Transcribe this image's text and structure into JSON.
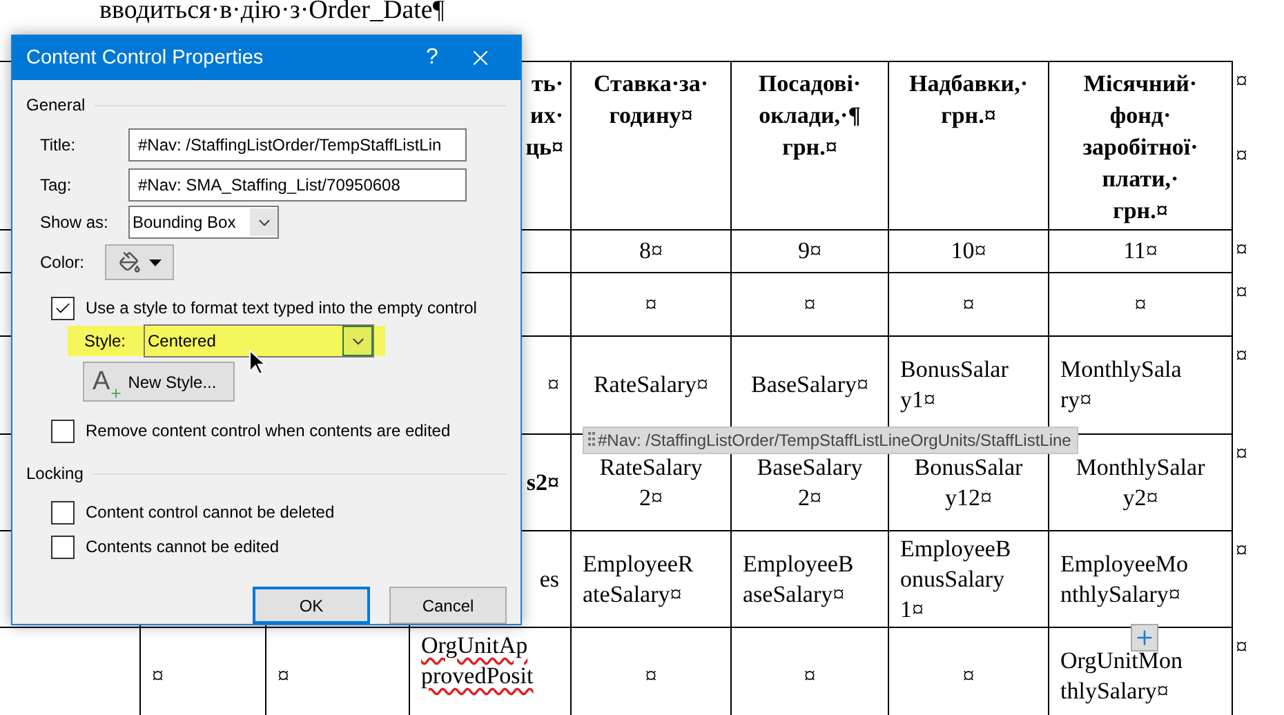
{
  "document": {
    "heading": "вводиться·в·дію·з·Order_Date¶",
    "rows": [
      {
        "kind": "header",
        "end_marks": [
          "¤",
          "¤"
        ],
        "cells": [
          {},
          {},
          {},
          {
            "text": "ть·\nих·\nць¤"
          },
          {
            "text": "Ставка·за·\nгодину¤"
          },
          {
            "text": "Посадові·\nоклади,·¶\nгрн.¤"
          },
          {
            "text": "Надбавки,·\nгрн.¤"
          },
          {
            "text": "Місячний·\nфонд·\nзаробітної·\nплати,·\nгрн.¤"
          }
        ]
      },
      {
        "kind": "body",
        "end_marks": [
          "¤"
        ],
        "cells": [
          {},
          {},
          {},
          {},
          {
            "text": "8¤"
          },
          {
            "text": "9¤"
          },
          {
            "text": "10¤"
          },
          {
            "text": "11¤"
          }
        ]
      },
      {
        "kind": "body",
        "end_marks": [
          "¤"
        ],
        "cells": [
          {},
          {},
          {},
          {},
          {
            "text": "¤"
          },
          {
            "text": "¤"
          },
          {
            "text": "¤"
          },
          {
            "text": "¤"
          }
        ]
      },
      {
        "kind": "body",
        "end_marks": [
          "¤"
        ],
        "cells": [
          {},
          {},
          {},
          {
            "text": "¤"
          },
          {
            "text": "RateSalary¤"
          },
          {
            "text": "BaseSalary¤"
          },
          {
            "text": "BonusSalar\ny1¤"
          },
          {
            "text": "MonthlySala\nry¤"
          }
        ]
      },
      {
        "kind": "body",
        "end_marks": [
          "¤"
        ],
        "cells": [
          {},
          {},
          {},
          {
            "text": "s2¤",
            "bold": true
          },
          {
            "text": "RateSalary\n2¤"
          },
          {
            "text": "BaseSalary\n2¤"
          },
          {
            "text": "BonusSalar\ny12¤"
          },
          {
            "text": "MonthlySalar\ny2¤"
          }
        ]
      },
      {
        "kind": "body",
        "end_marks": [
          "¤"
        ],
        "cells": [
          {},
          {},
          {},
          {
            "text": "es"
          },
          {
            "text": "EmployeeR\nateSalary¤"
          },
          {
            "text": "EmployeeB\naseSalary¤"
          },
          {
            "text": "EmployeeB\nonusSalary\n1¤"
          },
          {
            "text": "EmployeeMo\nnthlySalary¤"
          }
        ]
      },
      {
        "kind": "body",
        "end_marks": [
          "¤"
        ],
        "cells": [
          {},
          {
            "text": "¤"
          },
          {
            "text": "¤"
          },
          {
            "text": "OrgUnitAp\nprovedPosit",
            "spelling_error": true
          },
          {
            "text": "¤"
          },
          {
            "text": "¤"
          },
          {
            "text": "¤"
          },
          {
            "text": "OrgUnitMon\nthlySalary¤"
          }
        ]
      }
    ]
  },
  "content_control_tag": "#Nav: /StaffingListOrder/TempStaffListLineOrgUnits/StaffListLine",
  "dialog": {
    "title": "Content Control Properties",
    "help": "?",
    "general": {
      "label": "General",
      "fields": [
        {
          "kind": "text",
          "label": "Title:",
          "value": "#Nav: /StaffingListOrder/TempStaffListLin"
        },
        {
          "kind": "text",
          "label": "Tag:",
          "value": "#Nav: SMA_Staffing_List/70950608"
        },
        {
          "kind": "select",
          "label": "Show as:",
          "value": "Bounding Box"
        },
        {
          "kind": "color",
          "label": "Color:"
        }
      ],
      "options": [
        {
          "kind": "checkbox",
          "label": "Use a style to format text typed into the empty control",
          "checked": true
        },
        {
          "kind": "style_select",
          "label": "Style:",
          "value": "Centered",
          "highlighted": true
        },
        {
          "kind": "button",
          "label": "New Style...",
          "icon_text": "A"
        },
        {
          "kind": "checkbox",
          "label": "Remove content control when contents are edited",
          "checked": false
        }
      ]
    },
    "locking": {
      "label": "Locking",
      "options": [
        {
          "kind": "checkbox",
          "label": "Content control cannot be deleted",
          "checked": false
        },
        {
          "kind": "checkbox",
          "label": "Contents cannot be edited",
          "checked": false
        }
      ]
    },
    "buttons": [
      {
        "label": "OK",
        "default": true
      },
      {
        "label": "Cancel",
        "default": false
      }
    ]
  }
}
